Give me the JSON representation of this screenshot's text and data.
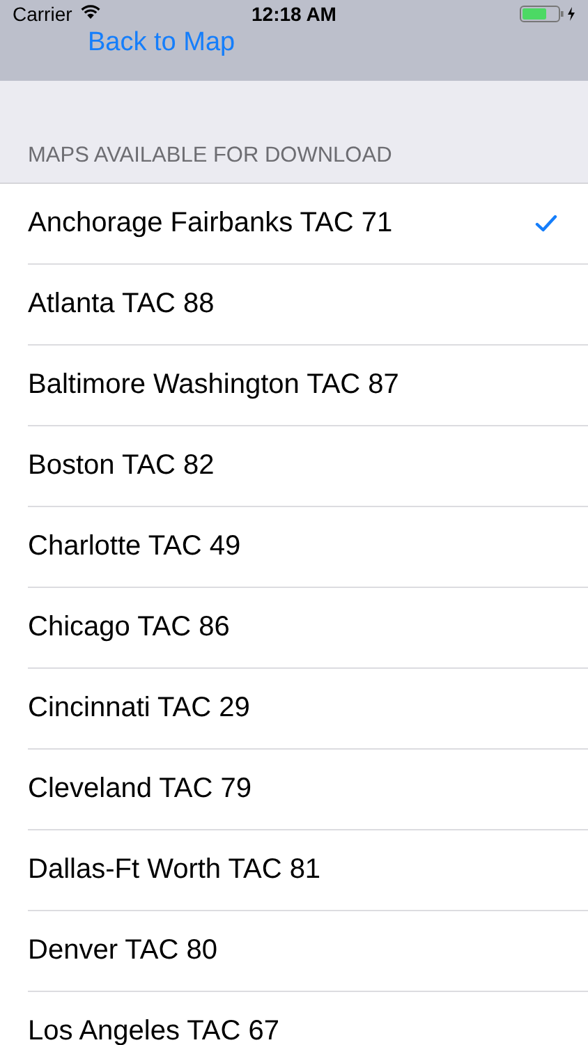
{
  "status_bar": {
    "carrier": "Carrier",
    "time": "12:18 AM"
  },
  "nav": {
    "back_label": "Back to Map"
  },
  "section": {
    "header": "MAPS AVAILABLE FOR DOWNLOAD"
  },
  "maps": [
    {
      "name": "Anchorage Fairbanks TAC 71",
      "selected": true
    },
    {
      "name": "Atlanta TAC 88",
      "selected": false
    },
    {
      "name": "Baltimore Washington TAC 87",
      "selected": false
    },
    {
      "name": "Boston TAC 82",
      "selected": false
    },
    {
      "name": "Charlotte TAC 49",
      "selected": false
    },
    {
      "name": "Chicago TAC 86",
      "selected": false
    },
    {
      "name": "Cincinnati TAC 29",
      "selected": false
    },
    {
      "name": "Cleveland TAC 79",
      "selected": false
    },
    {
      "name": "Dallas-Ft Worth TAC 81",
      "selected": false
    },
    {
      "name": "Denver TAC 80",
      "selected": false
    },
    {
      "name": "Los Angeles TAC 67",
      "selected": false
    }
  ]
}
